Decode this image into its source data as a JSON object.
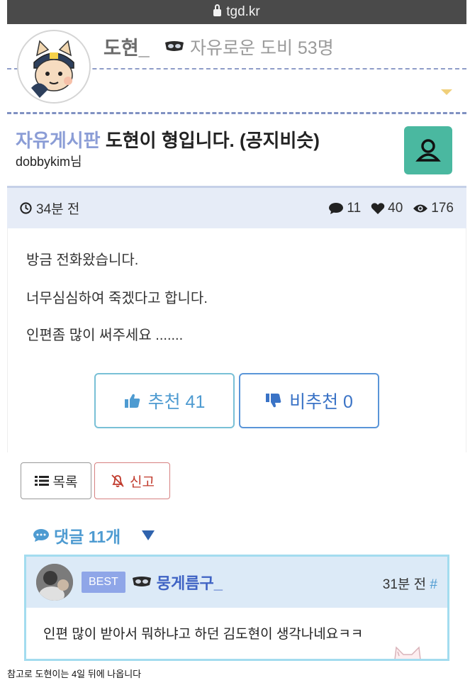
{
  "browser": {
    "url": "tgd.kr"
  },
  "profile": {
    "nickname": "도현_",
    "level_text": "자유로운 도비 53명"
  },
  "post": {
    "board_name": "자유게시판",
    "title": "도현이 형입니다. (공지비슷)",
    "author": "dobbykim님",
    "time_ago": "34분 전",
    "stats": {
      "comments": "11",
      "likes": "40",
      "views": "176"
    },
    "content_lines": [
      "방금 전화왔습니다.",
      "너무심심하여 죽겠다고 합니다.",
      "인편좀 많이 써주세요 ......."
    ]
  },
  "actions": {
    "upvote_label": "추천 41",
    "downvote_label": "비추천 0",
    "list_label": "목록",
    "report_label": "신고"
  },
  "comments": {
    "header": "댓글 11개",
    "items": [
      {
        "badge": "BEST",
        "nickname": "뭉게름구_",
        "time": "31분 전",
        "hash": "#",
        "text": "인편 많이 받아서 뭐하냐고 하던 김도현이 생각나네요ㅋㅋ"
      }
    ]
  },
  "caption": "참고로 도현이는 4일 뒤에 나옵니다",
  "colors": {
    "board_accent": "#8b9dd6",
    "user_button": "#4ab8a0",
    "vote_border": "#79c0d6"
  }
}
